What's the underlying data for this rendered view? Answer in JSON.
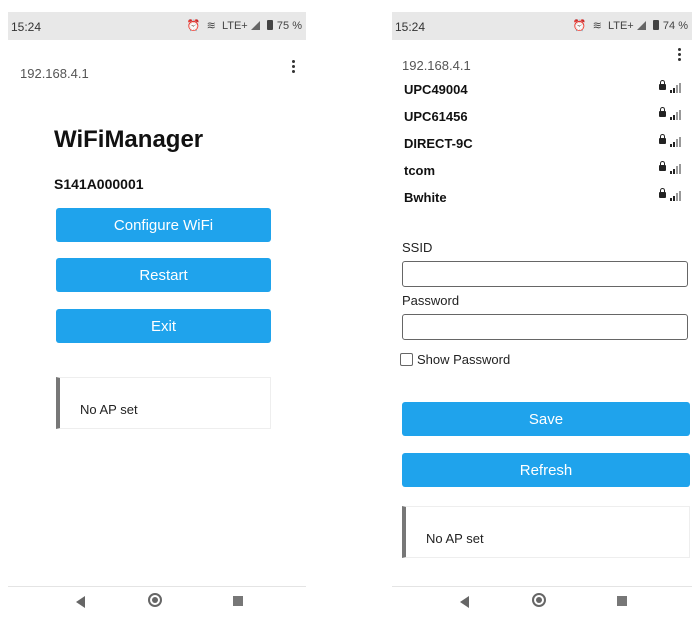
{
  "left_screen": {
    "status": {
      "time": "15:24",
      "network": "LTE+",
      "battery": "75 %"
    },
    "url": "192.168.4.1",
    "title": "WiFiManager",
    "device_id": "S141A000001",
    "buttons": {
      "configure": "Configure WiFi",
      "restart": "Restart",
      "exit": "Exit"
    },
    "message": "No AP set"
  },
  "right_screen": {
    "status": {
      "time": "15:24",
      "network": "LTE+",
      "battery": "74 %"
    },
    "url": "192.168.4.1",
    "networks": [
      {
        "name": "UPC49004",
        "signal": 2
      },
      {
        "name": "UPC61456",
        "signal": 2
      },
      {
        "name": "DIRECT-9C",
        "signal": 2
      },
      {
        "name": "tcom",
        "signal": 2
      },
      {
        "name": "Bwhite",
        "signal": 2
      }
    ],
    "ssid_label": "SSID",
    "ssid_value": "",
    "password_label": "Password",
    "password_value": "",
    "show_password_label": "Show Password",
    "buttons": {
      "save": "Save",
      "refresh": "Refresh"
    },
    "message": "No AP set"
  },
  "colors": {
    "button": "#1fa3ec",
    "status_bar": "#e8e8e8",
    "message_border": "#777777"
  }
}
